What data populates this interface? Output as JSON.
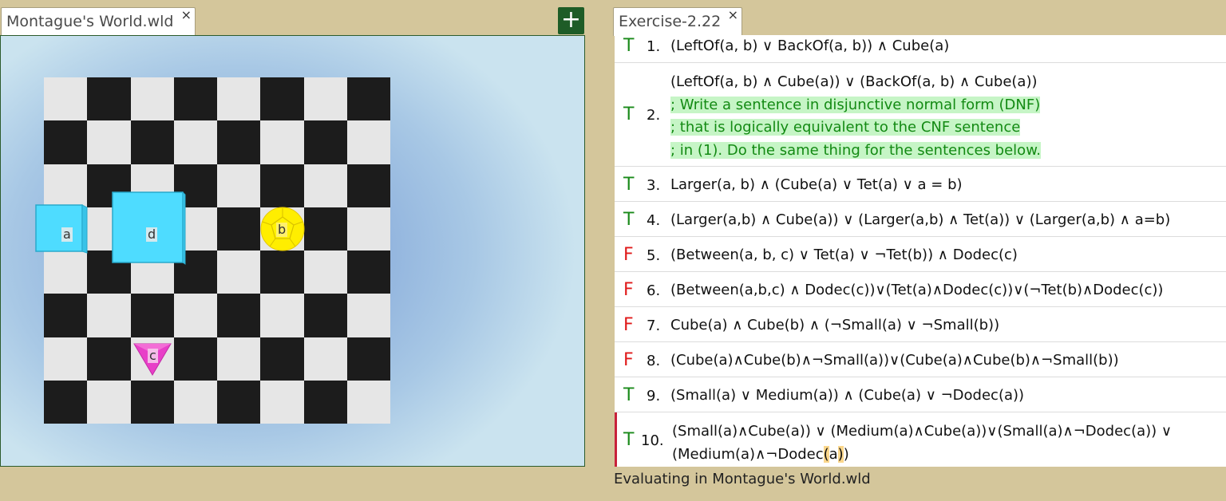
{
  "world": {
    "tab_title": "Montague's World.wld",
    "close_glyph": "×",
    "add_glyph": "+",
    "objects": [
      {
        "label": "a",
        "shape": "cube",
        "color": "#4edcff"
      },
      {
        "label": "d",
        "shape": "cube",
        "color": "#4edcff"
      },
      {
        "label": "b",
        "shape": "dodec",
        "color": "#ffee00"
      },
      {
        "label": "c",
        "shape": "tet",
        "color": "#e83fc8"
      }
    ]
  },
  "sentences": {
    "tab_title": "Exercise-2.22",
    "close_glyph": "×",
    "rows": [
      {
        "truth": "T",
        "number": "1.",
        "lines": [
          "(LeftOf(a, b) ∨ BackOf(a, b)) ∧ Cube(a)"
        ]
      },
      {
        "truth": "T",
        "number": "2.",
        "lines": [
          "(LeftOf(a, b)  ∧  Cube(a)) ∨ (BackOf(a, b) ∧ Cube(a))"
        ],
        "comments": [
          "; Write a sentence in disjunctive normal form (DNF)",
          "; that is logically equivalent to the CNF sentence",
          "; in (1).  Do the same thing for the sentences below."
        ]
      },
      {
        "truth": "T",
        "number": "3.",
        "lines": [
          "Larger(a, b) ∧ (Cube(a) ∨ Tet(a) ∨ a = b)"
        ]
      },
      {
        "truth": "T",
        "number": "4.",
        "lines": [
          "(Larger(a,b)  ∧ Cube(a)) ∨ (Larger(a,b) ∧ Tet(a)) ∨ (Larger(a,b) ∧ a=b)"
        ]
      },
      {
        "truth": "F",
        "number": "5.",
        "lines": [
          "(Between(a, b, c) ∨ Tet(a) ∨ ¬Tet(b)) ∧ Dodec(c)"
        ]
      },
      {
        "truth": "F",
        "number": "6.",
        "lines": [
          "(Between(a,b,c) ∧ Dodec(c))∨(Tet(a)∧Dodec(c))∨(¬Tet(b)∧Dodec(c))"
        ]
      },
      {
        "truth": "F",
        "number": "7.",
        "lines": [
          "Cube(a) ∧ Cube(b) ∧ (¬Small(a) ∨ ¬Small(b))"
        ]
      },
      {
        "truth": "F",
        "number": "8.",
        "lines": [
          "(Cube(a)∧Cube(b)∧¬Small(a))∨(Cube(a)∧Cube(b)∧¬Small(b))"
        ]
      },
      {
        "truth": "T",
        "number": "9.",
        "lines": [
          "(Small(a) ∨ Medium(a)) ∧ (Cube(a) ∨ ¬Dodec(a))"
        ]
      },
      {
        "truth": "T",
        "number": "10.",
        "lines": [
          "(Small(a)∧Cube(a)) ∨ (Medium(a)∧Cube(a))∨(Small(a)∧¬Dodec(a)) ∨"
        ],
        "last_line": {
          "pre": "(Medium(a)∧¬Dodec",
          "hl1": "(",
          "mid": "a",
          "hl2": ")",
          "post": ")"
        }
      }
    ]
  },
  "status": "Evaluating in Montague's World.wld"
}
